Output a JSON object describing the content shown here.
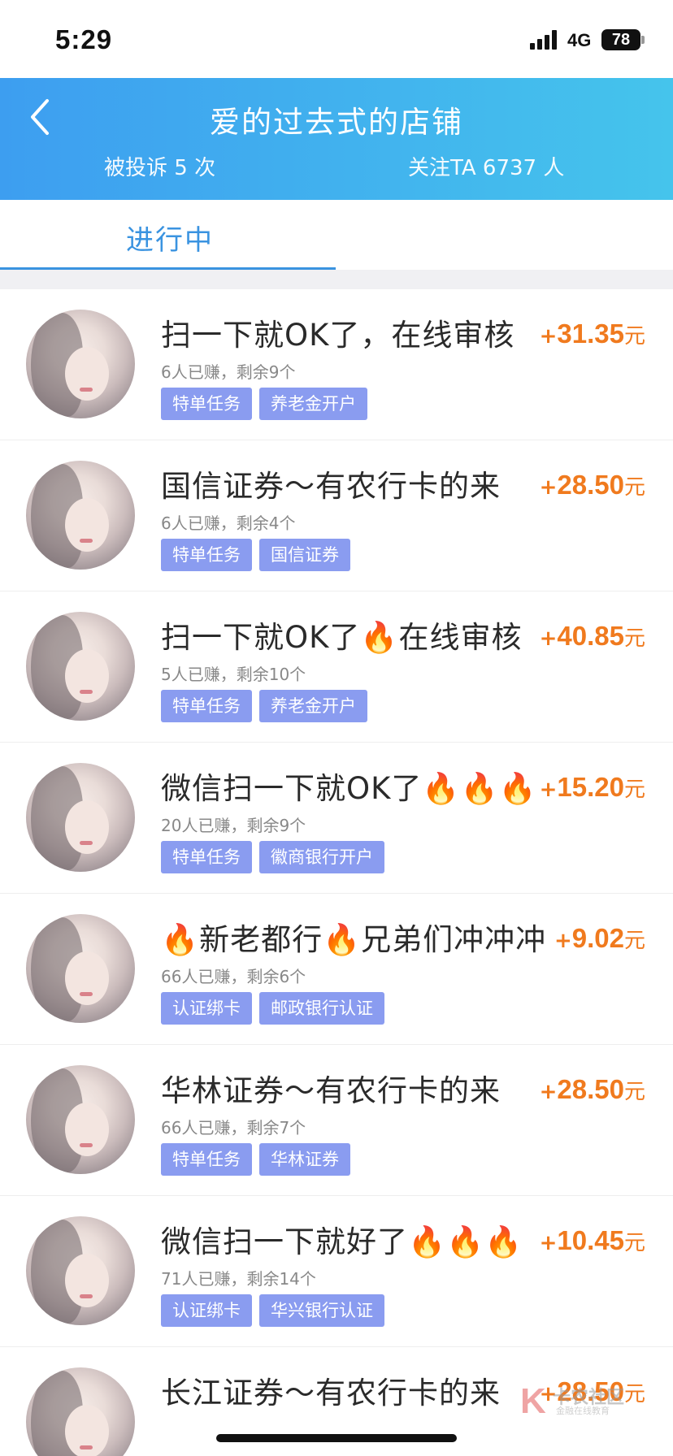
{
  "status_bar": {
    "time": "5:29",
    "network": "4G",
    "battery": "78"
  },
  "header": {
    "title": "爱的过去式的店铺",
    "complaints": "被投诉 5 次",
    "followers": "关注TA 6737 人"
  },
  "tabs": {
    "active": "进行中"
  },
  "tasks": [
    {
      "title": "扫一下就OK了，在线审核",
      "meta": "6人已赚，剩余9个",
      "tags": [
        "特单任务",
        "养老金开户"
      ],
      "plus": "+",
      "amount": "31.35",
      "unit": "元"
    },
    {
      "title": "国信证券～有农行卡的来",
      "meta": "6人已赚，剩余4个",
      "tags": [
        "特单任务",
        "国信证券"
      ],
      "plus": "+",
      "amount": "28.50",
      "unit": "元"
    },
    {
      "title": "扫一下就OK了🔥在线审核",
      "meta": "5人已赚，剩余10个",
      "tags": [
        "特单任务",
        "养老金开户"
      ],
      "plus": "+",
      "amount": "40.85",
      "unit": "元"
    },
    {
      "title": "微信扫一下就OK了🔥🔥🔥",
      "meta": "20人已赚，剩余9个",
      "tags": [
        "特单任务",
        "徽商银行开户"
      ],
      "plus": "+",
      "amount": "15.20",
      "unit": "元"
    },
    {
      "title": "🔥新老都行🔥兄弟们冲冲冲",
      "meta": "66人已赚，剩余6个",
      "tags": [
        "认证绑卡",
        "邮政银行认证"
      ],
      "plus": "+",
      "amount": "9.02",
      "unit": "元"
    },
    {
      "title": "华林证券～有农行卡的来",
      "meta": "66人已赚，剩余7个",
      "tags": [
        "特单任务",
        "华林证券"
      ],
      "plus": "+",
      "amount": "28.50",
      "unit": "元"
    },
    {
      "title": "微信扫一下就好了🔥🔥🔥",
      "meta": "71人已赚，剩余14个",
      "tags": [
        "认证绑卡",
        "华兴银行认证"
      ],
      "plus": "+",
      "amount": "10.45",
      "unit": "元"
    },
    {
      "title": "长江证券～有农行卡的来",
      "meta": "",
      "tags": [],
      "plus": "+",
      "amount": "28.50",
      "unit": "元"
    }
  ],
  "watermark": {
    "brand": "卡农社区",
    "sub": "金融在线教育"
  }
}
